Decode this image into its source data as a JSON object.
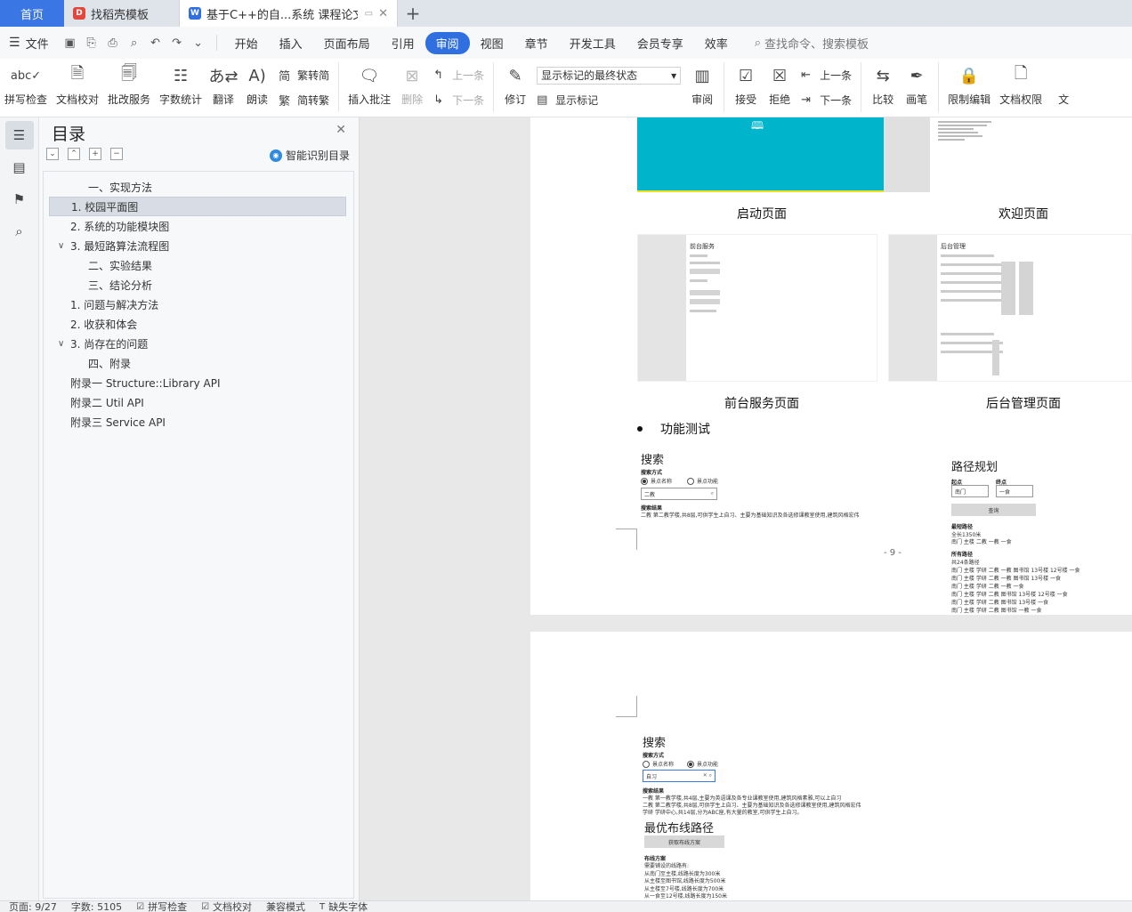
{
  "tabs": {
    "home": "首页",
    "template": "找稻壳模板",
    "document": "基于C++的自...系统 课程论文"
  },
  "menu": {
    "file": "文件",
    "items": [
      "开始",
      "插入",
      "页面布局",
      "引用",
      "审阅",
      "视图",
      "章节",
      "开发工具",
      "会员专享",
      "效率"
    ],
    "active_index": 4,
    "search": "查找命令、搜索模板"
  },
  "ribbon": {
    "spell": "拼写检查",
    "doc_check": "文档校对",
    "revise_service": "批改服务",
    "word_count": "字数统计",
    "translate": "翻译",
    "read_aloud": "朗读",
    "trad_to_simp": "繁转简",
    "simp_to_trad": "简转繁",
    "insert_comment": "插入批注",
    "delete": "删除",
    "prev": "上一条",
    "next": "下一条",
    "revise": "修订",
    "markup_state": "显示标记的最终状态",
    "show_markup": "显示标记",
    "review": "审阅",
    "accept": "接受",
    "reject": "拒绝",
    "prev2": "上一条",
    "next2": "下一条",
    "compare": "比较",
    "ink": "画笔",
    "restrict": "限制编辑",
    "doc_permission": "文档权限",
    "cut_char": "文"
  },
  "toc": {
    "title": "目录",
    "smart": "智能识别目录",
    "items": [
      {
        "label": "一、实现方法",
        "level": 2,
        "caret": ""
      },
      {
        "label": "1. 校园平面图",
        "level": 1,
        "caret": "",
        "selected": true
      },
      {
        "label": "2. 系统的功能模块图",
        "level": 1,
        "caret": ""
      },
      {
        "label": "3. 最短路算法流程图",
        "level": 1,
        "caret": "∨"
      },
      {
        "label": "二、实验结果",
        "level": 2,
        "caret": ""
      },
      {
        "label": "三、结论分析",
        "level": 2,
        "caret": ""
      },
      {
        "label": "1. 问题与解决方法",
        "level": 1,
        "caret": ""
      },
      {
        "label": "2. 收获和体会",
        "level": 1,
        "caret": ""
      },
      {
        "label": "3. 尚存在的问题",
        "level": 1,
        "caret": "∨"
      },
      {
        "label": "四、附录",
        "level": 2,
        "caret": ""
      },
      {
        "label": "附录一 Structure::Library API",
        "level": 0,
        "caret": ""
      },
      {
        "label": "附录二 Util API",
        "level": 0,
        "caret": ""
      },
      {
        "label": "附录三 Service API",
        "level": 0,
        "caret": ""
      }
    ]
  },
  "doc": {
    "captions": {
      "launch": "启动页面",
      "welcome": "欢迎页面",
      "front": "前台服务页面",
      "back": "后台管理页面"
    },
    "shot_titles": {
      "front": "前台服务",
      "back": "后台管理"
    },
    "bullet": "功能测试",
    "search1": {
      "title": "搜索",
      "mode_label": "搜索方式",
      "opt1": "景点名称",
      "opt2": "景点功能",
      "input": "二教",
      "result_label": "搜索结果",
      "result": "二教 第二教学楼,共8层,可供学生上自习、主要为基础知识及各选修课教室使用,建筑风格宏伟"
    },
    "route": {
      "title": "路径规划",
      "start_label": "起点",
      "end_label": "终点",
      "start": "南门",
      "end": "一食",
      "button": "查询",
      "shortest_label": "最短路径",
      "shortest_len": "全长1350米",
      "shortest_path": "南门 主楼 二教 一教 一食",
      "all_label": "所有路径",
      "all_count": "共24条路径",
      "paths": [
        "南门 主楼 学研 二教 一教 图书馆 13号楼 12号楼 一食",
        "南门 主楼 学研 二教 一教 图书馆 13号楼 一食",
        "南门 主楼 学研 二教 一教 一食",
        "南门 主楼 学研 二教 图书馆 13号楼 12号楼 一食",
        "南门 主楼 学研 二教 图书馆 13号楼 一食",
        "南门 主楼 学研 二教 图书馆 一教 一食"
      ]
    },
    "page_number": "- 9 -",
    "search2": {
      "title": "搜索",
      "mode_label": "搜索方式",
      "opt1": "景点名称",
      "opt2": "景点功能",
      "input": "自习",
      "result_label": "搜索结果",
      "results": [
        "一教 第一教学楼,共4层,主要为英语课及各专业课教室使用,建筑风格素雅,可以上自习",
        "二教 第二教学楼,共8层,可供学生上自习、主要为基础知识及各选修课教室使用,建筑风格宏伟",
        "学研 学研中心,共14层,分为ABC座,有大量的教室,可供学生上自习。"
      ]
    },
    "wiring": {
      "title": "最优布线路径",
      "button": "获取布线方案",
      "plan_label": "布线方案",
      "lines": [
        "需要铺设的线路有:",
        "从南门至主楼,线路长度为300米",
        "从主楼至图书馆,线路长度为500米",
        "从主楼至7号楼,线路长度为700米",
        "从一食至12号楼,线路长度为150米"
      ]
    }
  },
  "status": {
    "page": "页面: 9/27",
    "words": "字数: 5105",
    "spell": "拼写检查",
    "doc_check": "文档校对",
    "compat": "兼容模式",
    "missing_font": "缺失字体"
  }
}
